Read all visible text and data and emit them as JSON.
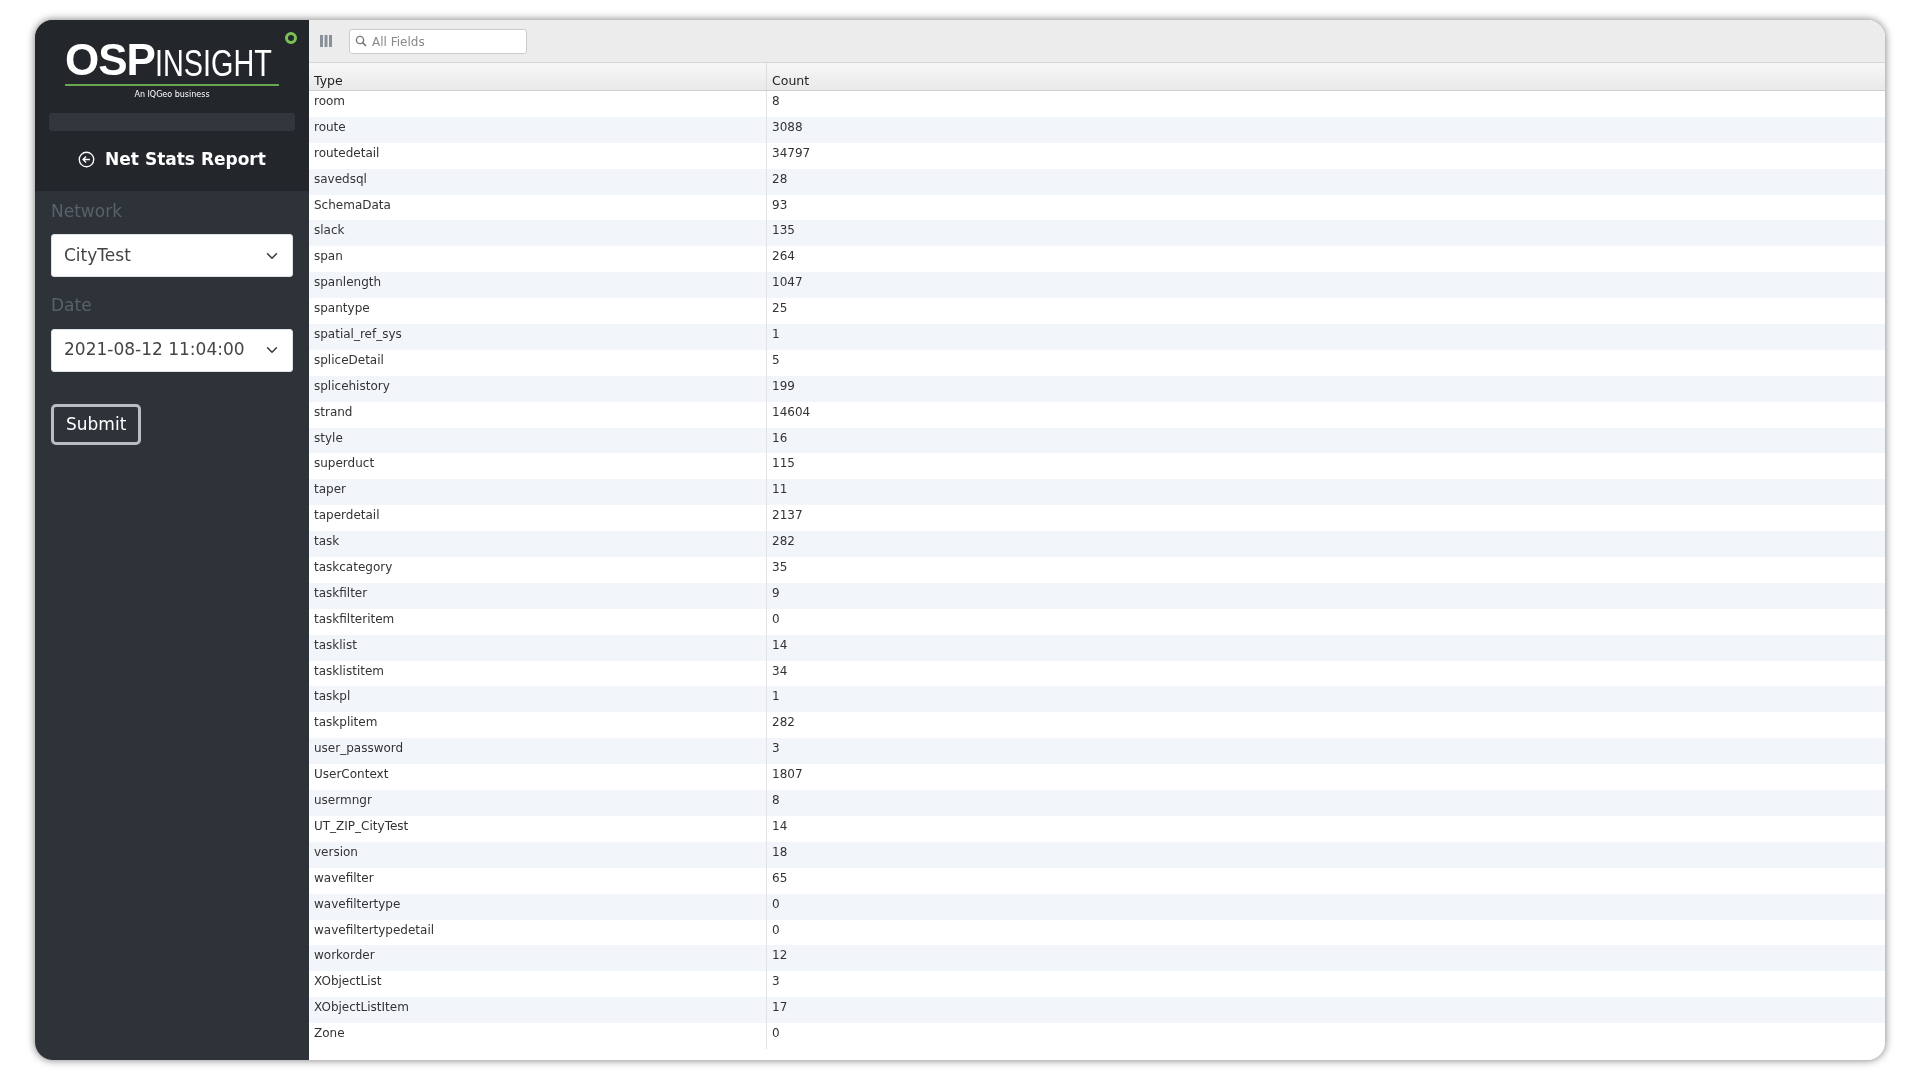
{
  "logo": {
    "primary": "OSP",
    "secondary": "INSIGHT",
    "tagline": "An IQGeo business"
  },
  "sidebar": {
    "title": "Net Stats Report",
    "fields": [
      {
        "label": "Network",
        "value": "CityTest"
      },
      {
        "label": "Date",
        "value": "2021-08-12 11:04:00"
      }
    ],
    "submit": "Submit"
  },
  "toolbar": {
    "search": {
      "placeholder": "All Fields"
    }
  },
  "table": {
    "columns": [
      "Type",
      "Count"
    ],
    "rows": [
      [
        "room",
        "8"
      ],
      [
        "route",
        "3088"
      ],
      [
        "routedetail",
        "34797"
      ],
      [
        "savedsql",
        "28"
      ],
      [
        "SchemaData",
        "93"
      ],
      [
        "slack",
        "135"
      ],
      [
        "span",
        "264"
      ],
      [
        "spanlength",
        "1047"
      ],
      [
        "spantype",
        "25"
      ],
      [
        "spatial_ref_sys",
        "1"
      ],
      [
        "spliceDetail",
        "5"
      ],
      [
        "splicehistory",
        "199"
      ],
      [
        "strand",
        "14604"
      ],
      [
        "style",
        "16"
      ],
      [
        "superduct",
        "115"
      ],
      [
        "taper",
        "11"
      ],
      [
        "taperdetail",
        "2137"
      ],
      [
        "task",
        "282"
      ],
      [
        "taskcategory",
        "35"
      ],
      [
        "taskfilter",
        "9"
      ],
      [
        "taskfilteritem",
        "0"
      ],
      [
        "tasklist",
        "14"
      ],
      [
        "tasklistitem",
        "34"
      ],
      [
        "taskpl",
        "1"
      ],
      [
        "taskplitem",
        "282"
      ],
      [
        "user_password",
        "3"
      ],
      [
        "UserContext",
        "1807"
      ],
      [
        "usermngr",
        "8"
      ],
      [
        "UT_ZIP_CityTest",
        "14"
      ],
      [
        "version",
        "18"
      ],
      [
        "wavefilter",
        "65"
      ],
      [
        "wavefiltertype",
        "0"
      ],
      [
        "wavefiltertypedetail",
        "0"
      ],
      [
        "workorder",
        "12"
      ],
      [
        "XObjectList",
        "3"
      ],
      [
        "XObjectListItem",
        "17"
      ],
      [
        "Zone",
        "0"
      ]
    ]
  }
}
